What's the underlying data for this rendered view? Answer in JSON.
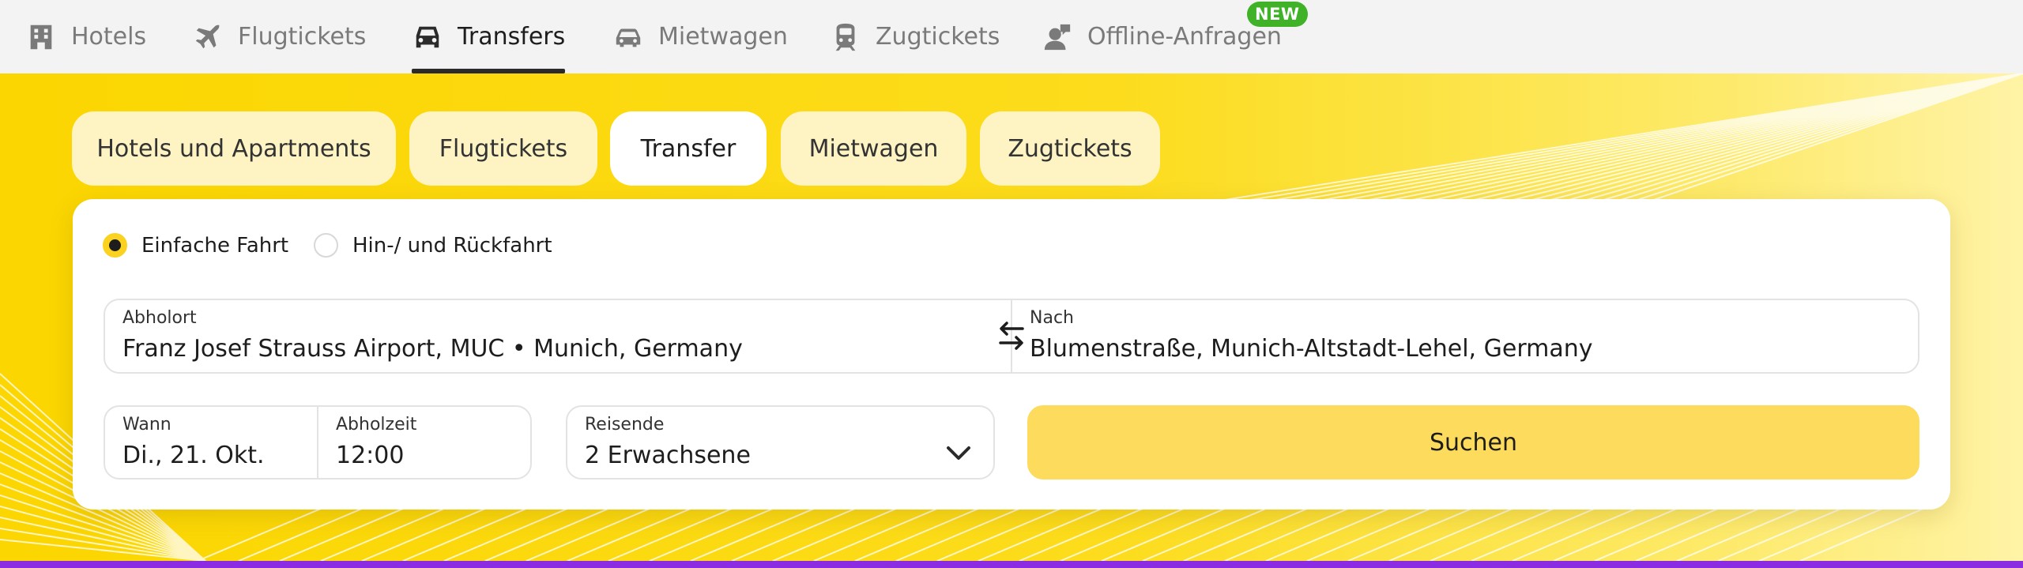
{
  "nav": {
    "items": [
      {
        "label": "Hotels",
        "icon": "hotel-icon"
      },
      {
        "label": "Flugtickets",
        "icon": "airplane-icon"
      },
      {
        "label": "Transfers",
        "icon": "car-front-icon",
        "active": true
      },
      {
        "label": "Mietwagen",
        "icon": "rental-car-icon"
      },
      {
        "label": "Zugtickets",
        "icon": "train-icon"
      },
      {
        "label": "Offline-Anfragen",
        "icon": "person-chat-icon"
      }
    ],
    "badge": "NEW"
  },
  "tabs": [
    {
      "label": "Hotels und Apartments"
    },
    {
      "label": "Flugtickets"
    },
    {
      "label": "Transfer",
      "active": true
    },
    {
      "label": "Mietwagen"
    },
    {
      "label": "Zugtickets"
    }
  ],
  "trip_type": {
    "options": [
      {
        "label": "Einfache Fahrt",
        "checked": true
      },
      {
        "label": "Hin-/ und Rückfahrt",
        "checked": false
      }
    ]
  },
  "form": {
    "pickup": {
      "label": "Abholort",
      "value": "Franz Josef Strauss Airport, MUC • Munich, Germany"
    },
    "destination": {
      "label": "Nach",
      "value": "Blumenstraße, Munich-Altstadt-Lehel, Germany"
    },
    "date": {
      "label": "Wann",
      "value": "Di., 21. Okt."
    },
    "time": {
      "label": "Abholzeit",
      "value": "12:00"
    },
    "travelers": {
      "label": "Reisende",
      "value": "2 Erwachsene"
    },
    "search_label": "Suchen"
  },
  "colors": {
    "brand_yellow": "#fbd903",
    "button_yellow": "#fddb5c",
    "badge_green": "#3fb227",
    "accent_purple": "#8b2be2"
  }
}
